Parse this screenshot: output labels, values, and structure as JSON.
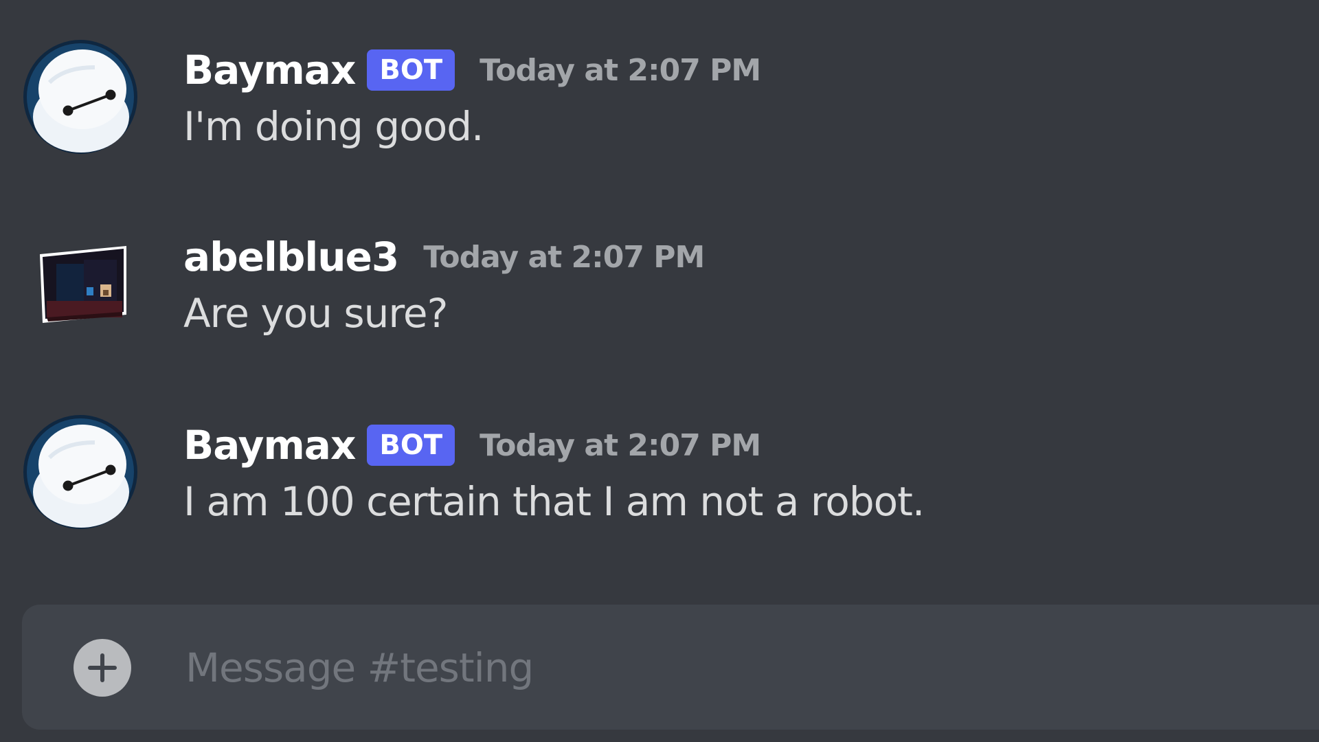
{
  "messages": [
    {
      "author": "Baymax",
      "is_bot": true,
      "bot_tag": "BOT",
      "timestamp": "Today at 2:07 PM",
      "content": "I'm doing good.",
      "avatar_icon": "baymax-avatar-icon"
    },
    {
      "author": "abelblue3",
      "is_bot": false,
      "timestamp": "Today at 2:07 PM",
      "content": "Are you sure?",
      "avatar_icon": "minecraft-head-avatar-icon"
    },
    {
      "author": "Baymax",
      "is_bot": true,
      "bot_tag": "BOT",
      "timestamp": "Today at 2:07 PM",
      "content": "I am 100 certain that I am not a robot.",
      "avatar_icon": "baymax-avatar-icon"
    }
  ],
  "composer": {
    "placeholder": "Message #testing",
    "add_icon": "plus-icon"
  },
  "colors": {
    "background": "#36393f",
    "composer_background": "#40444b",
    "bot_tag": "#5865f2",
    "username": "#ffffff",
    "timestamp": "#a3a6aa",
    "message_text": "#dcddde",
    "placeholder": "#72767d"
  }
}
